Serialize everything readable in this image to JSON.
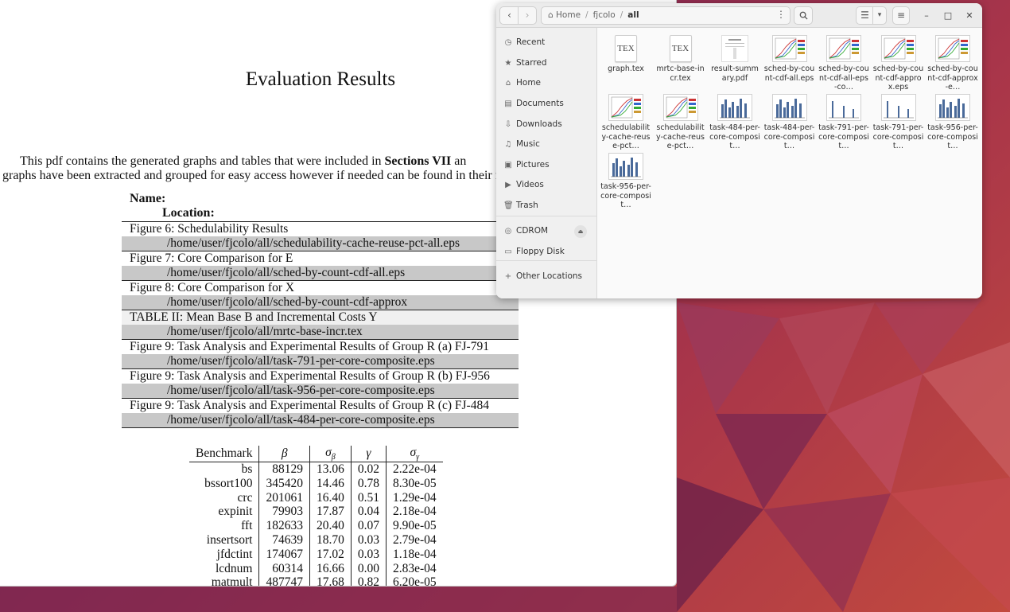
{
  "pdf": {
    "title": "Evaluation Results",
    "para_line1_a": "This pdf contains the generated graphs and tables that were included in ",
    "para_line1_b": "Sections VII",
    "para_line1_c": " an",
    "para_line2": "graphs have been extracted and grouped for easy access however if needed can be found in their f",
    "header_name": "Name:",
    "header_location": "Location:",
    "figures": [
      {
        "name": "Figure 6: Schedulability Results",
        "path": "/home/user/fjcolo/all/schedulability-cache-reuse-pct-all.eps"
      },
      {
        "name": "Figure 7: Core Comparison for E",
        "path": "/home/user/fjcolo/all/sched-by-count-cdf-all.eps"
      },
      {
        "name": "Figure 8: Core Comparison for X",
        "path": "/home/user/fjcolo/all/sched-by-count-cdf-approx"
      },
      {
        "name": "TABLE II: Mean Base B and Incremental Costs Y",
        "path": "/home/user/fjcolo/all/mrtc-base-incr.tex"
      },
      {
        "name": "Figure 9: Task Analysis and Experimental Results of Group R (a) FJ-791",
        "path": "/home/user/fjcolo/all/task-791-per-core-composite.eps"
      },
      {
        "name": "Figure 9: Task Analysis and Experimental Results of Group R (b) FJ-956",
        "path": "/home/user/fjcolo/all/task-956-per-core-composite.eps"
      },
      {
        "name": "Figure 9: Task Analysis and Experimental Results of Group R (c) FJ-484",
        "path": "/home/user/fjcolo/all/task-484-per-core-composite.eps"
      }
    ],
    "bench_headers": {
      "benchmark": "Benchmark",
      "beta": "β",
      "sigma": "σ",
      "gamma": "γ"
    },
    "bench_rows": [
      [
        "bs",
        "88129",
        "13.06",
        "0.02",
        "2.22e-04"
      ],
      [
        "bssort100",
        "345420",
        "14.46",
        "0.78",
        "8.30e-05"
      ],
      [
        "crc",
        "201061",
        "16.40",
        "0.51",
        "1.29e-04"
      ],
      [
        "expinit",
        "79903",
        "17.87",
        "0.04",
        "2.18e-04"
      ],
      [
        "fft",
        "182633",
        "20.40",
        "0.07",
        "9.90e-05"
      ],
      [
        "insertsort",
        "74639",
        "18.70",
        "0.03",
        "2.79e-04"
      ],
      [
        "jfdctint",
        "174067",
        "17.02",
        "0.03",
        "1.18e-04"
      ],
      [
        "lcdnum",
        "60314",
        "16.66",
        "0.00",
        "2.83e-04"
      ],
      [
        "matmult",
        "487747",
        "17.68",
        "0.82",
        "6.20e-05"
      ]
    ]
  },
  "files": {
    "path": {
      "home": "Home",
      "p1": "fjcolo",
      "p2": "all"
    },
    "sidebar": [
      {
        "label": "Recent",
        "icon": "clock-icon"
      },
      {
        "label": "Starred",
        "icon": "star-icon"
      },
      {
        "label": "Home",
        "icon": "home-icon"
      },
      {
        "label": "Documents",
        "icon": "document-icon"
      },
      {
        "label": "Downloads",
        "icon": "download-icon"
      },
      {
        "label": "Music",
        "icon": "music-icon"
      },
      {
        "label": "Pictures",
        "icon": "pictures-icon"
      },
      {
        "label": "Videos",
        "icon": "video-icon"
      },
      {
        "label": "Trash",
        "icon": "trash-icon"
      },
      {
        "label": "CDROM",
        "icon": "disc-icon"
      },
      {
        "label": "Floppy Disk",
        "icon": "drive-icon"
      },
      {
        "label": "Other Locations",
        "icon": "plus-icon"
      }
    ],
    "items": [
      {
        "name": "graph.tex",
        "kind": "tex"
      },
      {
        "name": "mrtc-base-incr.tex",
        "kind": "tex"
      },
      {
        "name": "result-summary.pdf",
        "kind": "pdf"
      },
      {
        "name": "sched-by-count-cdf-all.eps",
        "kind": "eps-line"
      },
      {
        "name": "sched-by-count-cdf-all-eps-co…",
        "kind": "eps-line"
      },
      {
        "name": "sched-by-count-cdf-approx.eps",
        "kind": "eps-line"
      },
      {
        "name": "sched-by-count-cdf-approx-e…",
        "kind": "eps-line"
      },
      {
        "name": "schedulability-cache-reuse-pct…",
        "kind": "eps-line"
      },
      {
        "name": "schedulability-cache-reuse-pct…",
        "kind": "eps-line"
      },
      {
        "name": "task-484-per-core-composit…",
        "kind": "eps-bar"
      },
      {
        "name": "task-484-per-core-composit…",
        "kind": "eps-bar"
      },
      {
        "name": "task-791-per-core-composit…",
        "kind": "eps-bar-sparse"
      },
      {
        "name": "task-791-per-core-composit…",
        "kind": "eps-bar-sparse"
      },
      {
        "name": "task-956-per-core-composit…",
        "kind": "eps-bar"
      },
      {
        "name": "task-956-per-core-composit…",
        "kind": "eps-bar"
      }
    ],
    "tex_icon_text": "TEX"
  },
  "colors": {
    "accent_bar": "#4a6a9a",
    "desktop": "#8a2a52"
  }
}
